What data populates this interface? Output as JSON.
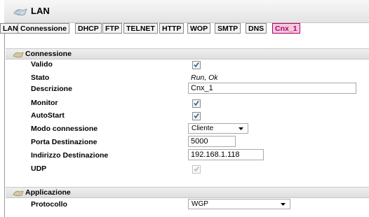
{
  "window": {
    "title": "LAN",
    "icon": "network-lan-icon"
  },
  "tabs": [
    {
      "label": "LAN",
      "active": false
    },
    {
      "label": "Connessione",
      "active": false
    },
    {
      "label": "DHCP",
      "active": false
    },
    {
      "label": "FTP",
      "active": false
    },
    {
      "label": "TELNET",
      "active": false
    },
    {
      "label": "HTTP",
      "active": false
    },
    {
      "label": "WOP",
      "active": false
    },
    {
      "label": "SMTP",
      "active": false
    },
    {
      "label": "DNS",
      "active": false
    },
    {
      "label": "Cnx_1",
      "active": true
    }
  ],
  "sections": {
    "connessione": {
      "title": "Connessione",
      "icon": "section-link-icon",
      "fields": {
        "valido": {
          "label": "Valido",
          "checked": true
        },
        "stato": {
          "label": "Stato",
          "value": "Run, Ok"
        },
        "descrizione": {
          "label": "Descrizione",
          "value": "Cnx_1"
        },
        "monitor": {
          "label": "Monitor",
          "checked": true
        },
        "autostart": {
          "label": "AutoStart",
          "checked": true
        },
        "modo": {
          "label": "Modo connessione",
          "value": "Cliente"
        },
        "porta": {
          "label": "Porta Destinazione",
          "value": "5000"
        },
        "indirizzo": {
          "label": "Indirizzo Destinazione",
          "value": "192.168.1.118"
        },
        "udp": {
          "label": "UDP",
          "checked": true,
          "disabled": true
        }
      }
    },
    "applicazione": {
      "title": "Applicazione",
      "icon": "section-link-icon",
      "fields": {
        "protocollo": {
          "label": "Protocollo",
          "value": "WGP"
        }
      }
    }
  },
  "colors": {
    "active_tab_bg": "#f3c9dc",
    "active_tab_text": "#b0006a"
  }
}
